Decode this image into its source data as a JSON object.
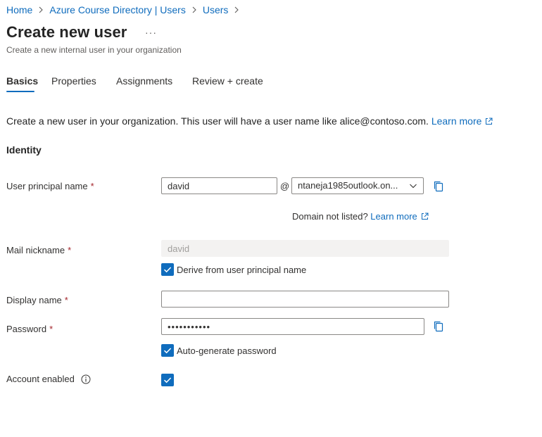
{
  "breadcrumb": [
    "Home",
    "Azure Course Directory | Users",
    "Users"
  ],
  "header": {
    "title": "Create new user",
    "more": "···",
    "subtitle": "Create a new internal user in your organization"
  },
  "tabs": [
    {
      "label": "Basics",
      "active": true
    },
    {
      "label": "Properties",
      "active": false
    },
    {
      "label": "Assignments",
      "active": false
    },
    {
      "label": "Review + create",
      "active": false
    }
  ],
  "intro": {
    "text": "Create a new user in your organization. This user will have a user name like alice@contoso.com.",
    "link": "Learn more"
  },
  "identity": {
    "heading": "Identity",
    "upn": {
      "label": "User principal name",
      "required": "*",
      "value": "david",
      "at": "@",
      "domain": "ntaneja1985outlook.on...",
      "domain_hint": "Domain not listed?",
      "domain_link": "Learn more"
    },
    "mail_nickname": {
      "label": "Mail nickname",
      "required": "*",
      "value": "david",
      "derive_label": "Derive from user principal name",
      "derive_checked": true
    },
    "display_name": {
      "label": "Display name",
      "required": "*",
      "value": ""
    },
    "password": {
      "label": "Password",
      "required": "*",
      "value": "•••••••••••",
      "auto_label": "Auto-generate password",
      "auto_checked": true
    },
    "account_enabled": {
      "label": "Account enabled",
      "checked": true
    }
  },
  "colors": {
    "accent": "#0f6cbd",
    "required": "#a4262c",
    "text": "#323130"
  },
  "icons": [
    "chevron-right-icon",
    "ext-link-icon",
    "chevron-down-icon",
    "copy-icon",
    "checkmark-icon",
    "info-icon"
  ]
}
